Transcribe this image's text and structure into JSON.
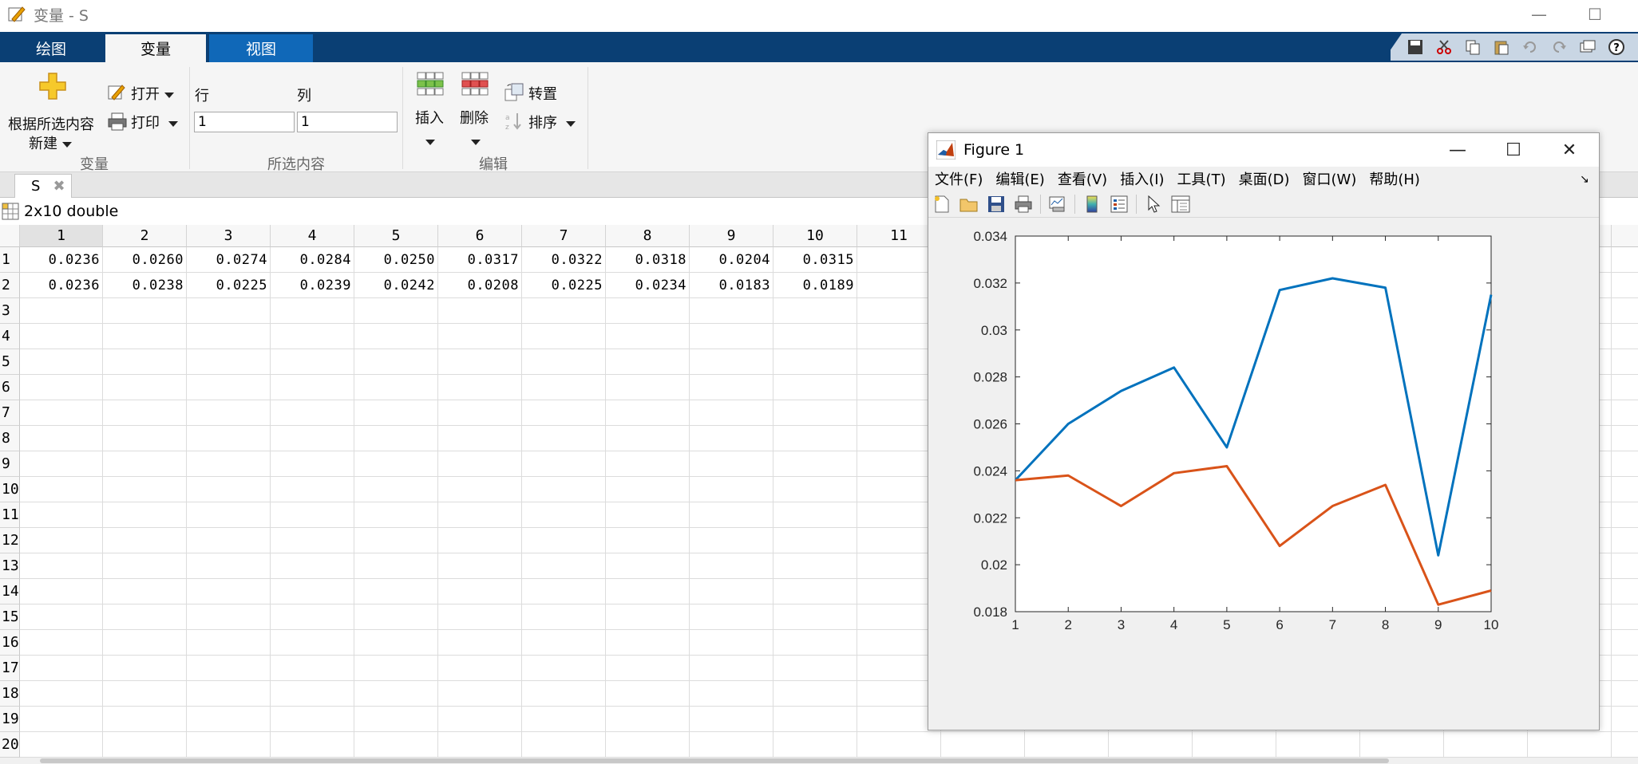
{
  "window": {
    "title": "变量 - S"
  },
  "ribbon_tabs": [
    {
      "label": "绘图"
    },
    {
      "label": "变量"
    },
    {
      "label": "视图"
    }
  ],
  "ribbon": {
    "new_from_selection_line1": "根据所选内容",
    "new_from_selection_line2": "新建",
    "open_label": "打开",
    "print_label": "打印",
    "row_label": "行",
    "col_label": "列",
    "row_value": "1",
    "col_value": "1",
    "insert_label": "插入",
    "delete_label": "删除",
    "transpose_label": "转置",
    "sort_label": "排序",
    "group_variable": "变量",
    "group_selection": "所选内容",
    "group_edit": "编辑"
  },
  "doc_tab": {
    "label": "S"
  },
  "variable_info": "2x10 double",
  "table": {
    "col_headers": [
      "1",
      "2",
      "3",
      "4",
      "5",
      "6",
      "7",
      "8",
      "9",
      "10",
      "11"
    ],
    "row_headers": [
      "1",
      "2",
      "3",
      "4",
      "5",
      "6",
      "7",
      "8",
      "9",
      "10",
      "11",
      "12",
      "13",
      "14",
      "15",
      "16",
      "17",
      "18",
      "19",
      "20"
    ],
    "rows": [
      [
        "0.0236",
        "0.0260",
        "0.0274",
        "0.0284",
        "0.0250",
        "0.0317",
        "0.0322",
        "0.0318",
        "0.0204",
        "0.0315"
      ],
      [
        "0.0236",
        "0.0238",
        "0.0225",
        "0.0239",
        "0.0242",
        "0.0208",
        "0.0225",
        "0.0234",
        "0.0183",
        "0.0189"
      ]
    ]
  },
  "figure": {
    "title": "Figure 1",
    "menus": [
      "文件(F)",
      "编辑(E)",
      "查看(V)",
      "插入(I)",
      "工具(T)",
      "桌面(D)",
      "窗口(W)",
      "帮助(H)"
    ]
  },
  "chart_data": {
    "type": "line",
    "x": [
      1,
      2,
      3,
      4,
      5,
      6,
      7,
      8,
      9,
      10
    ],
    "series": [
      {
        "values": [
          0.0236,
          0.026,
          0.0274,
          0.0284,
          0.025,
          0.0317,
          0.0322,
          0.0318,
          0.0204,
          0.0315
        ],
        "color": "#0072bd"
      },
      {
        "values": [
          0.0236,
          0.0238,
          0.0225,
          0.0239,
          0.0242,
          0.0208,
          0.0225,
          0.0234,
          0.0183,
          0.0189
        ],
        "color": "#d95319"
      }
    ],
    "xlim": [
      1,
      10
    ],
    "ylim": [
      0.018,
      0.034
    ],
    "xticks": [
      "1",
      "2",
      "3",
      "4",
      "5",
      "6",
      "7",
      "8",
      "9",
      "10"
    ],
    "yticks": [
      "0.018",
      "0.02",
      "0.022",
      "0.024",
      "0.026",
      "0.028",
      "0.03",
      "0.032",
      "0.034"
    ],
    "grid": false
  }
}
